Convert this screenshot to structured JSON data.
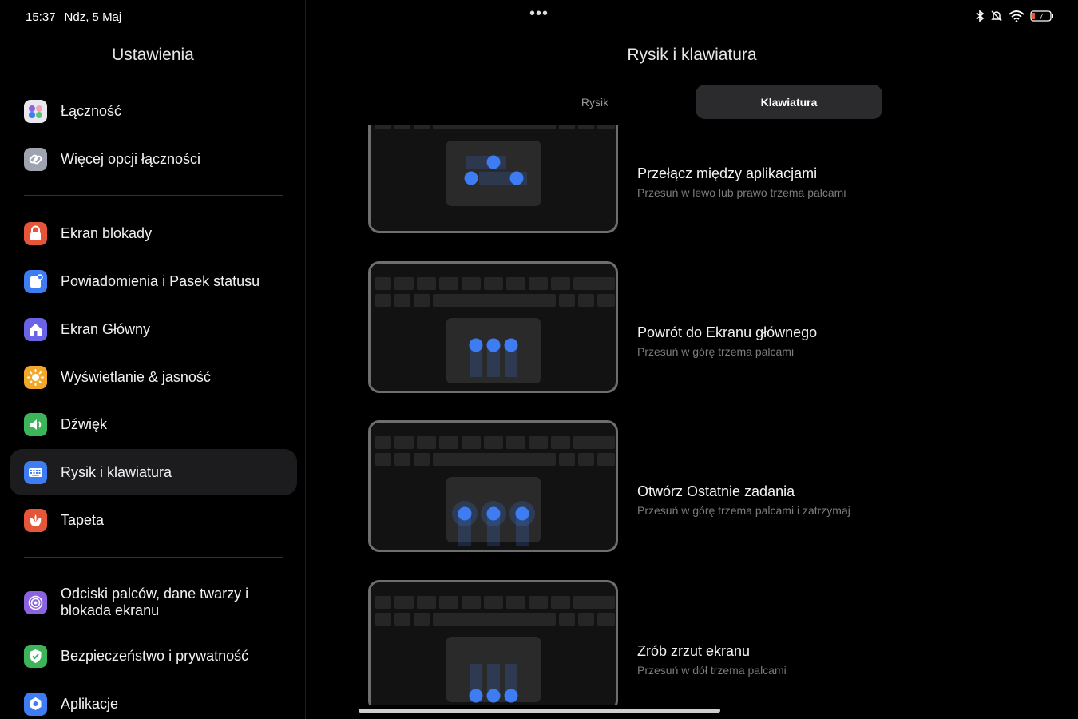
{
  "status": {
    "time": "15:37",
    "date": "Ndz, 5 Maj",
    "battery": "7"
  },
  "sidebar": {
    "title": "Ustawienia",
    "items": [
      {
        "label": "Łączność",
        "icon": "connectivity-icon",
        "color": "#e8e8ee"
      },
      {
        "label": "Więcej opcji łączności",
        "icon": "link-icon",
        "color": "#9fa3b0"
      },
      {
        "label": "Ekran blokady",
        "icon": "lock-icon",
        "color": "#e4553a"
      },
      {
        "label": "Powiadomienia i Pasek statusu",
        "icon": "notification-icon",
        "color": "#3d7cf2"
      },
      {
        "label": "Ekran Główny",
        "icon": "home-icon",
        "color": "#6a63e8"
      },
      {
        "label": "Wyświetlanie & jasność",
        "icon": "sun-icon",
        "color": "#f0a72a"
      },
      {
        "label": "Dźwięk",
        "icon": "speaker-icon",
        "color": "#3cb55a"
      },
      {
        "label": "Rysik i klawiatura",
        "icon": "keyboard-icon",
        "color": "#3d7cf2"
      },
      {
        "label": "Tapeta",
        "icon": "flower-icon",
        "color": "#e4553a"
      },
      {
        "label_line1": "Odciski palców, dane twarzy i",
        "label_line2": "blokada ekranu",
        "icon": "fingerprint-icon",
        "color": "#8b63e0"
      },
      {
        "label": "Bezpieczeństwo i prywatność",
        "icon": "shield-icon",
        "color": "#3cb55a"
      },
      {
        "label": "Aplikacje",
        "icon": "apps-icon",
        "color": "#3d7cf2"
      }
    ]
  },
  "main": {
    "title": "Rysik i klawiatura",
    "tabs": [
      {
        "label": "Rysik"
      },
      {
        "label": "Klawiatura"
      }
    ],
    "gestures": [
      {
        "title": "Przełącz między aplikacjami",
        "desc": "Przesuń w lewo lub prawo trzema palcami"
      },
      {
        "title": "Powrót do Ekranu głównego",
        "desc": "Przesuń w górę trzema palcami"
      },
      {
        "title": "Otwórz Ostatnie zadania",
        "desc": "Przesuń w górę trzema palcami i zatrzymaj"
      },
      {
        "title": "Zrób zrzut ekranu",
        "desc": "Przesuń w dół trzema palcami"
      }
    ]
  },
  "colors": {
    "accent": "#3d7cf2",
    "active_bg": "#1c1c1e",
    "background": "#000000"
  }
}
